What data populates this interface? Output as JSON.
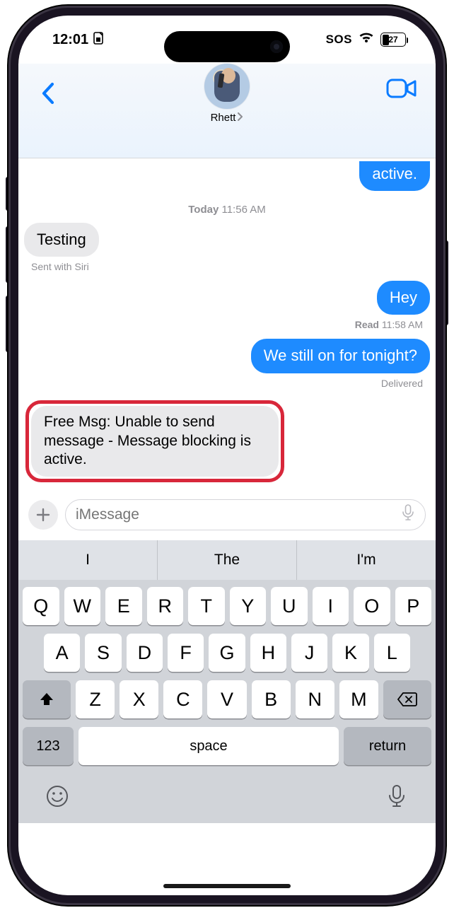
{
  "status": {
    "time": "12:01",
    "sos": "SOS",
    "battery_pct": "27"
  },
  "header": {
    "contact_name": "Rhett"
  },
  "chat": {
    "partial_sent": "active.",
    "ts_day": "Today",
    "ts_time": "11:56 AM",
    "recv1": "Testing",
    "recv1_meta": "Sent with Siri",
    "sent1": "Hey",
    "sent1_meta_label": "Read",
    "sent1_meta_time": "11:58 AM",
    "sent2": "We still on for tonight?",
    "sent2_meta": "Delivered",
    "recv2": "Free Msg: Unable to send message - Message blocking is active."
  },
  "input": {
    "placeholder": "iMessage"
  },
  "suggestions": {
    "s1": "I",
    "s2": "The",
    "s3": "I'm"
  },
  "keys": {
    "r1": [
      "Q",
      "W",
      "E",
      "R",
      "T",
      "Y",
      "U",
      "I",
      "O",
      "P"
    ],
    "r2": [
      "A",
      "S",
      "D",
      "F",
      "G",
      "H",
      "J",
      "K",
      "L"
    ],
    "r3": [
      "Z",
      "X",
      "C",
      "V",
      "B",
      "N",
      "M"
    ],
    "abc": "123",
    "space": "space",
    "return": "return"
  }
}
